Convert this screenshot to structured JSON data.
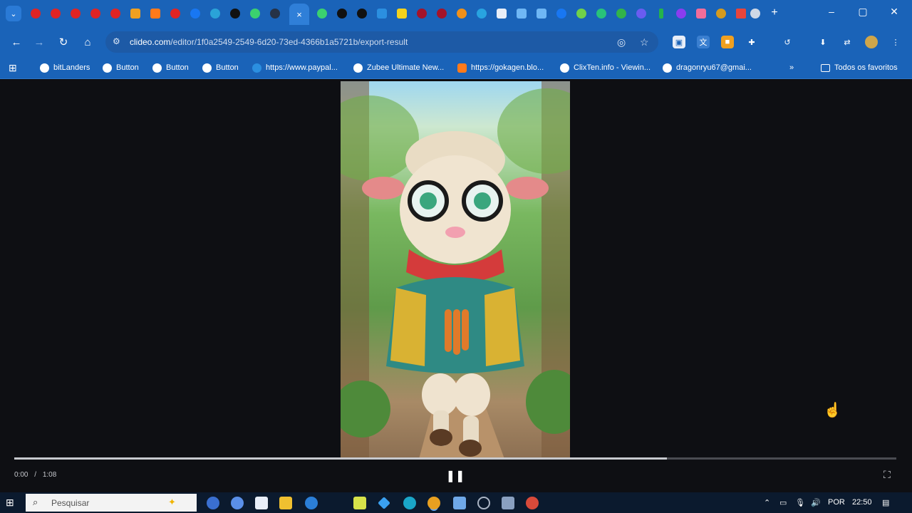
{
  "browser": {
    "url_host": "clideo.com",
    "url_path": "/editor/1f0a2549-2549-6d20-73ed-4366b1a5721b/export-result",
    "tab_active_close": "×",
    "window_controls": [
      "–",
      "▢",
      "✕"
    ]
  },
  "bookmarks": [
    {
      "label": "bitLanders"
    },
    {
      "label": "Button"
    },
    {
      "label": "Button"
    },
    {
      "label": "Button"
    },
    {
      "label": "https://www.paypal..."
    },
    {
      "label": "Zubee Ultimate New..."
    },
    {
      "label": "https://gokagen.blo..."
    },
    {
      "label": "ClixTen.info - Viewin..."
    },
    {
      "label": "dragonryu67@gmai..."
    },
    {
      "label": "»"
    },
    {
      "label": "Todos os favoritos"
    }
  ],
  "player": {
    "current_time": "0:00",
    "separator": "/",
    "duration": "1:08",
    "progress_fraction": 0.74
  },
  "taskbar": {
    "search_placeholder": "Pesquisar",
    "language": "POR",
    "clock": "22:50"
  },
  "colors": {
    "chrome_blue": "#1a63b8",
    "stage_bg": "#0e0f13",
    "taskbar_bg": "#0b1a2e"
  }
}
